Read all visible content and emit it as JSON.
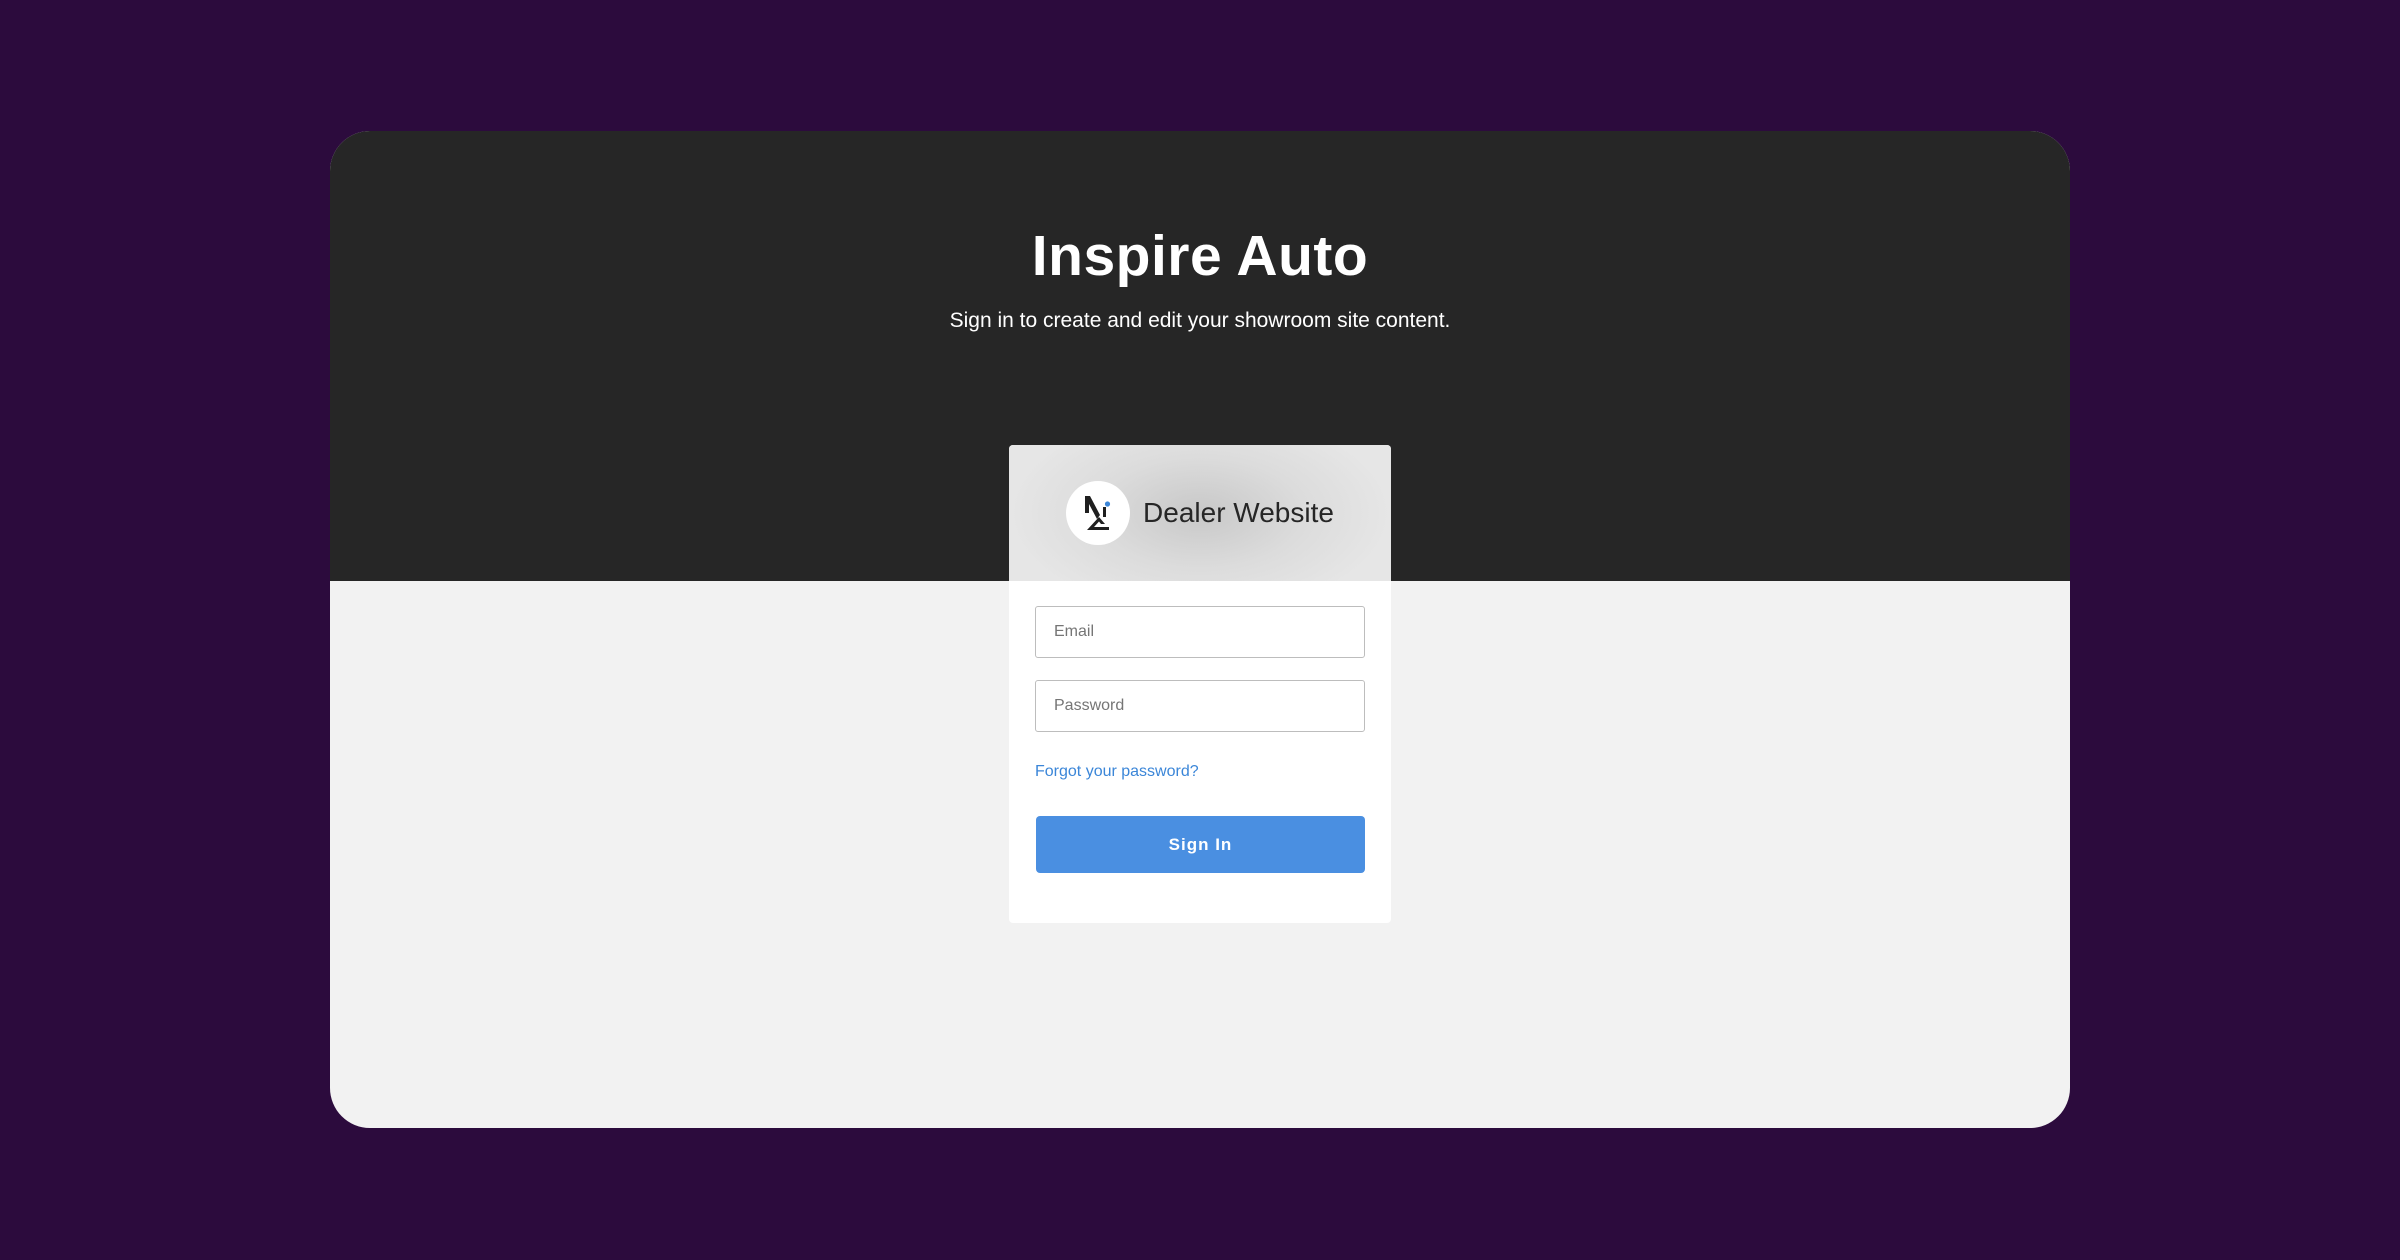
{
  "header": {
    "title": "Inspire Auto",
    "subtitle": "Sign in to create and edit your showroom site content."
  },
  "card": {
    "logo_icon": "dealer-logo-icon",
    "brand_name": "Dealer Website"
  },
  "form": {
    "email_placeholder": "Email",
    "email_value": "",
    "password_placeholder": "Password",
    "password_value": "",
    "forgot_label": "Forgot your password?",
    "submit_label": "Sign In"
  },
  "colors": {
    "page_background": "#2c0b3d",
    "header_background": "#262626",
    "body_background": "#f2f2f2",
    "link": "#3b86d8",
    "primary_button": "#4a8fe1"
  }
}
